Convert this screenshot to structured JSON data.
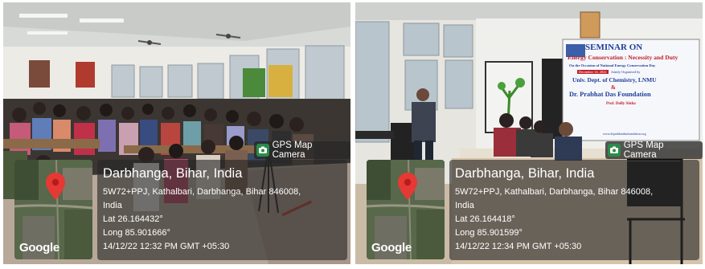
{
  "photos": [
    {
      "tag": {
        "text": "GPS Map Camera",
        "icon": "gps-map-camera-logo-icon"
      },
      "map": {
        "brand": "Google",
        "pin_icon": "map-pin-icon"
      },
      "location": {
        "city": "Darbhanga, Bihar, India",
        "address_line1": "5W72+PPJ, Kathalbari, Darbhanga, Bihar 846008,",
        "address_line2": "India",
        "lat": "Lat 26.164432°",
        "long": "Long 85.901666°",
        "datetime": "14/12/22 12:32 PM GMT +05:30"
      }
    },
    {
      "tag": {
        "text": "GPS Map Camera",
        "icon": "gps-map-camera-logo-icon"
      },
      "map": {
        "brand": "Google",
        "pin_icon": "map-pin-icon"
      },
      "location": {
        "city": "Darbhanga, Bihar, India",
        "address_line1": "5W72+PPJ, Kathalbari, Darbhanga, Bihar 846008,",
        "address_line2": "India",
        "lat": "Lat 26.164418°",
        "long": "Long 85.901599°",
        "datetime": "14/12/22 12:34 PM GMT +05:30"
      },
      "banner": {
        "title": "SEMINAR ON",
        "subtitle": "Energy Conservation : Necessity and Duty",
        "occasion": "On the Occasion of National Energy Conservation Day",
        "date": "December 14, 2022",
        "organised": "Jointly Organised by",
        "org1": "Univ. Dept. of Chemistry, LNMU",
        "amp": "&",
        "org2": "Dr. Prabhat Das Foundation",
        "speaker": "Prof. Dolly Sinha",
        "website": "www.drprabhatdasfoundation.org"
      }
    }
  ],
  "colors": {
    "overlay": "#262626",
    "tag_icon": "#2d8a4a",
    "pin": "#e53935",
    "banner_blue": "#1d3f9a",
    "banner_red": "#c0202a"
  }
}
